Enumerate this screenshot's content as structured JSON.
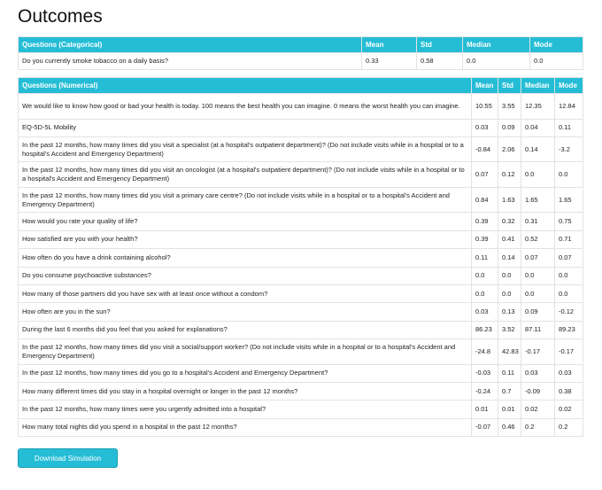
{
  "page_title": "Outcomes",
  "categorical": {
    "headers": [
      "Questions (Categorical)",
      "Mean",
      "Std",
      "Median",
      "Mode"
    ],
    "rows": [
      [
        "Do you currently smoke tobacco on a daily basis?",
        "0.33",
        "0.58",
        "0.0",
        "0.0"
      ]
    ]
  },
  "numerical": {
    "headers": [
      "Questions (Numerical)",
      "Mean",
      "Std",
      "Median",
      "Mode"
    ],
    "rows": [
      [
        "We would like to know how good or bad your health is today. 100 means the best health you can imagine. 0 means the worst health you can imagine.",
        "10.55",
        "3.55",
        "12.35",
        "12.84"
      ],
      [
        "EQ-5D-5L Mobility",
        "0.03",
        "0.09",
        "0.04",
        "0.11"
      ],
      [
        "In the past 12 months, how many times did you visit a specialist (at a hospital's outpatient department)? (Do not include visits while in a hospital or to a hospital's Accident and Emergency Department)",
        "-0.84",
        "2.06",
        "0.14",
        "-3.2"
      ],
      [
        "In the past 12 months, how many times did you visit an oncologist (at a hospital's outpatient department)? (Do not include visits while in a hospital or to a hospital's Accident and Emergency Department)",
        "0.07",
        "0.12",
        "0.0",
        "0.0"
      ],
      [
        "In the past 12 months, how many times did you visit a primary care centre? (Do not include visits while in a hospital or to a hospital's Accident and Emergency Department)",
        "0.84",
        "1.63",
        "1.65",
        "1.65"
      ],
      [
        "How would you rate your quality of life?",
        "0.39",
        "0.32",
        "0.31",
        "0.75"
      ],
      [
        "How satisfied are you with your health?",
        "0.39",
        "0.41",
        "0.52",
        "0.71"
      ],
      [
        "How often do you have a drink containing alcohol?",
        "0.11",
        "0.14",
        "0.07",
        "0.07"
      ],
      [
        "Do you consume psychoactive substances?",
        "0.0",
        "0.0",
        "0.0",
        "0.0"
      ],
      [
        "How many of those partners did you have sex with at least once without a condom?",
        "0.0",
        "0.0",
        "0.0",
        "0.0"
      ],
      [
        "How often are you in the sun?",
        "0.03",
        "0.13",
        "0.09",
        "-0.12"
      ],
      [
        "During the last 6 months did you feel that you asked for explanations?",
        "86.23",
        "3.52",
        "87.11",
        "89.23"
      ],
      [
        "In the past 12 months, how many times did you visit a social/support worker? (Do not include visits while in a hospital or to a hospital's Accident and Emergency Department)",
        "-24.8",
        "42.83",
        "-0.17",
        "-0.17"
      ],
      [
        "In the past 12 months, how many times did you go to a hospital's Accident and Emergency Department?",
        "-0.03",
        "0.11",
        "0.03",
        "0.03"
      ],
      [
        "How many different times did you stay in a hospital overnight or longer in the past 12 months?",
        "-0.24",
        "0.7",
        "-0.09",
        "0.38"
      ],
      [
        "In the past 12 months, how many times were you urgently admitted into a hospital?",
        "0.01",
        "0.01",
        "0.02",
        "0.02"
      ],
      [
        "How many total nights did you spend in a hospital in the past 12 months?",
        "-0.07",
        "0.46",
        "0.2",
        "0.2"
      ]
    ]
  },
  "download_button_label": "Download Simulation",
  "colors": {
    "header_bg": "#25bdd6",
    "header_text": "#ffffff",
    "border": "#e3e3e3"
  }
}
